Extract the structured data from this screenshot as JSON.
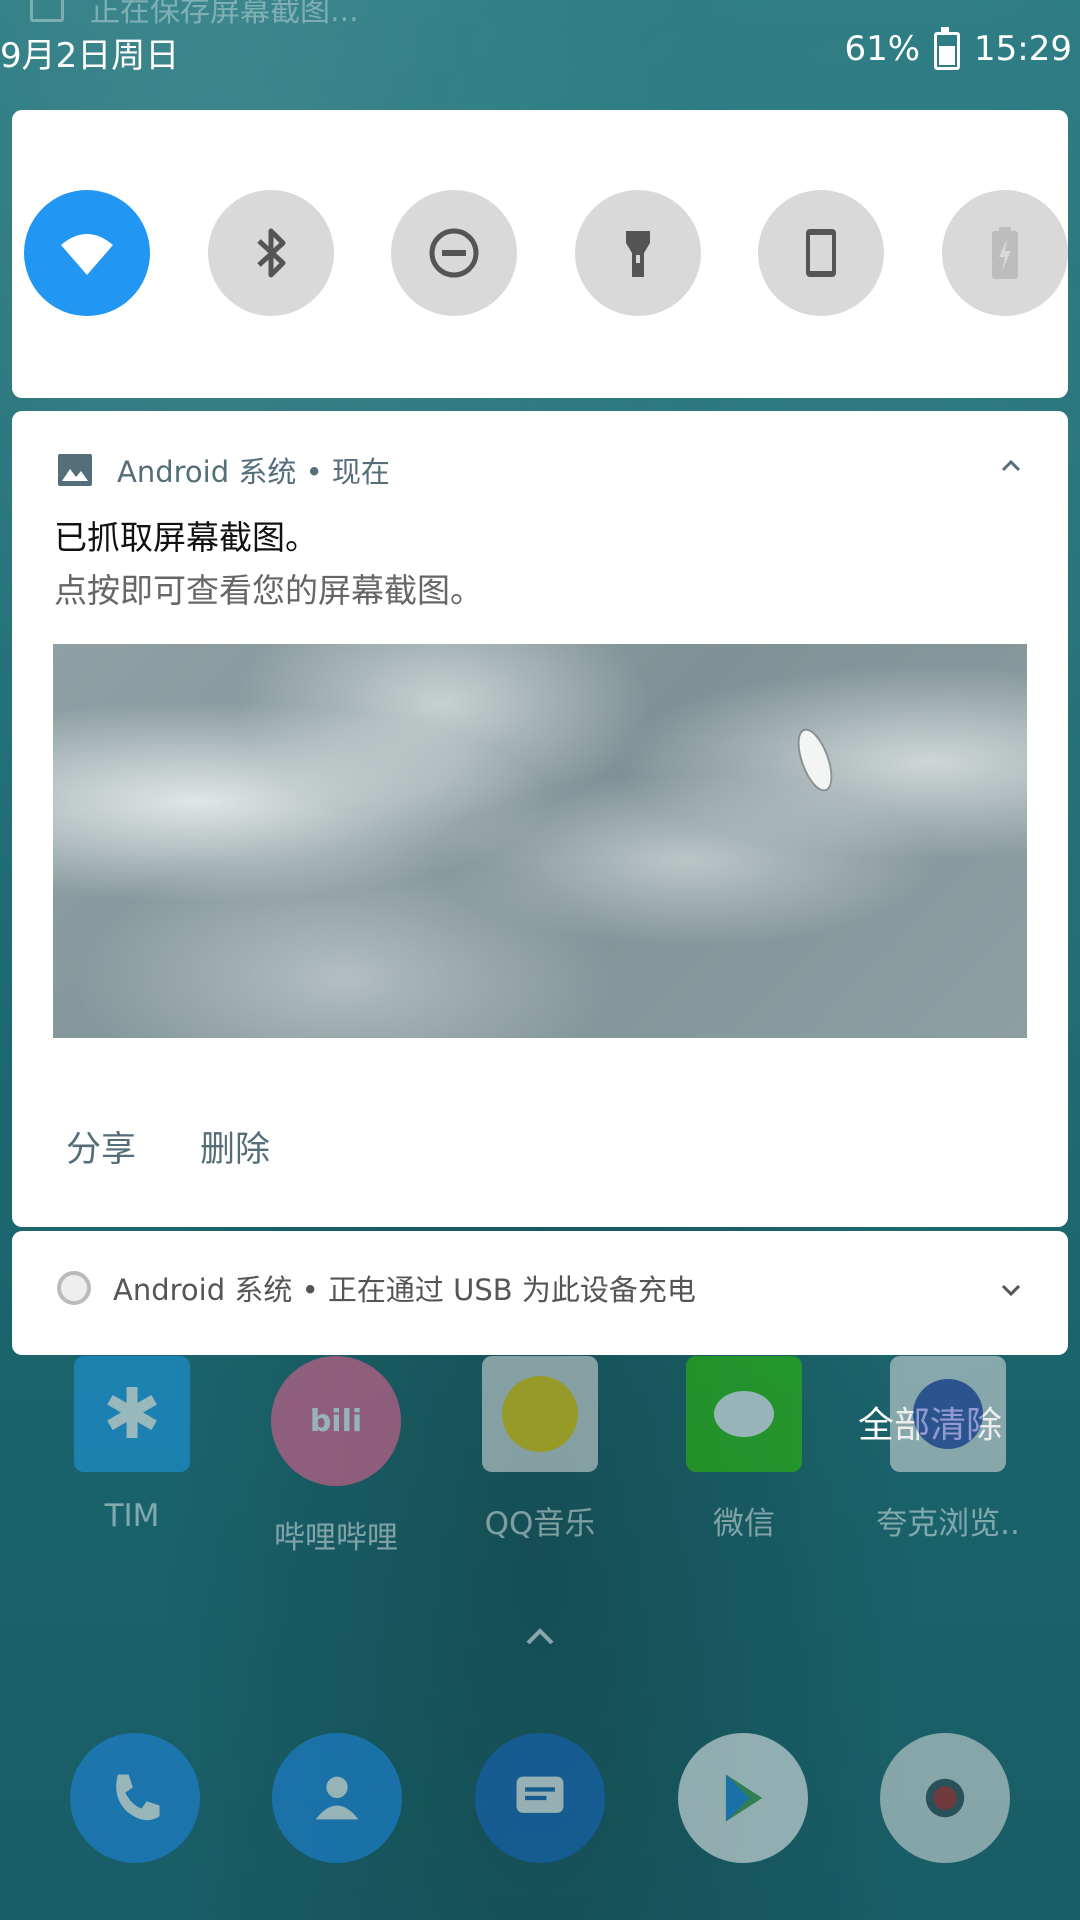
{
  "background_status": {
    "text": "正在保存屏幕截图..."
  },
  "status_bar": {
    "date": "9月2日周日",
    "battery": "61%",
    "time": "15:29"
  },
  "quick_settings": {
    "tiles": [
      {
        "name": "wifi",
        "icon": "wifi-icon",
        "active": true
      },
      {
        "name": "bluetooth",
        "icon": "bluetooth-icon",
        "active": false
      },
      {
        "name": "do-not-disturb",
        "icon": "do-not-disturb-icon",
        "active": false
      },
      {
        "name": "flashlight",
        "icon": "flashlight-icon",
        "active": false
      },
      {
        "name": "auto-rotate",
        "icon": "phone-rotate-icon",
        "active": false
      },
      {
        "name": "battery-saver",
        "icon": "battery-saver-icon",
        "active": false
      }
    ],
    "active_color": "#2196f3"
  },
  "notification_screenshot": {
    "app": "Android 系统",
    "time": "• 现在",
    "title": "已抓取屏幕截图。",
    "text": "点按即可查看您的屏幕截图。",
    "actions": {
      "share": "分享",
      "delete": "删除"
    }
  },
  "notification_usb": {
    "app": "Android 系统",
    "text": "• 正在通过 USB 为此设备充电"
  },
  "clear_all": "全部清除",
  "home_apps": [
    {
      "label": "TIM",
      "icon": "tim-icon"
    },
    {
      "label": "哔哩哔哩",
      "icon": "bilibili-icon"
    },
    {
      "label": "QQ音乐",
      "icon": "qq-music-icon"
    },
    {
      "label": "微信",
      "icon": "wechat-icon"
    },
    {
      "label": "夸克浏览..",
      "icon": "quark-browser-icon"
    }
  ],
  "dock": [
    {
      "name": "phone",
      "icon": "phone-icon"
    },
    {
      "name": "contacts",
      "icon": "contacts-icon"
    },
    {
      "name": "messages",
      "icon": "messages-icon"
    },
    {
      "name": "play-store",
      "icon": "play-store-icon"
    },
    {
      "name": "camera",
      "icon": "camera-icon"
    }
  ]
}
